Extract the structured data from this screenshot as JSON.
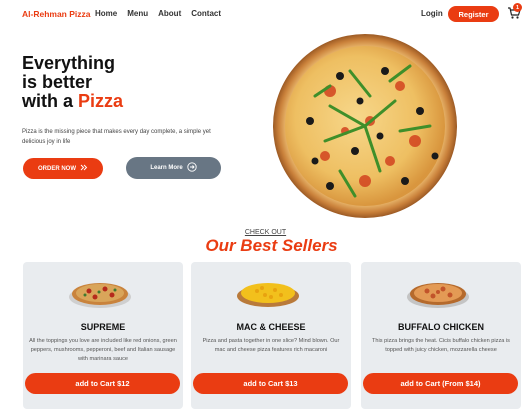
{
  "nav": {
    "logo": "Al-Rehman Pizza",
    "links": [
      "Home",
      "Menu",
      "About",
      "Contact"
    ],
    "login": "Login",
    "register": "Register",
    "cart_count": "1"
  },
  "hero": {
    "title_line1": "Everything",
    "title_line2": "is better",
    "title_line3_prefix": "with a ",
    "title_accent": "Pizza",
    "description": "Pizza is the missing piece that makes every day complete, a simple yet delicious joy in life",
    "order_button": "ORDER NOW",
    "learn_button": "Learn More"
  },
  "best_sellers": {
    "checkout_label": "CHECK OUT",
    "heading": "Our Best Sellers",
    "items": [
      {
        "name": "SUPREME",
        "description": "All the toppings you love are included like red onions, green peppers, mushrooms, pepperoni, beef and Italian sausage with marinara sauce",
        "button": "add to Cart $12"
      },
      {
        "name": "MAC & CHEESE",
        "description": "Pizza and pasta together in one slice? Mind blown. Our mac and cheese pizza features rich macaroni",
        "button": "add to Cart $13"
      },
      {
        "name": "BUFFALO CHICKEN",
        "description": "This pizza brings the heat. Cicis buffalo chicken pizza is topped with juicy chicken, mozzarella cheese",
        "button": "add to Cart (From $14)"
      }
    ]
  },
  "colors": {
    "accent": "#ea3c12",
    "secondary_button": "#687684",
    "card_bg": "#e9ecef"
  }
}
